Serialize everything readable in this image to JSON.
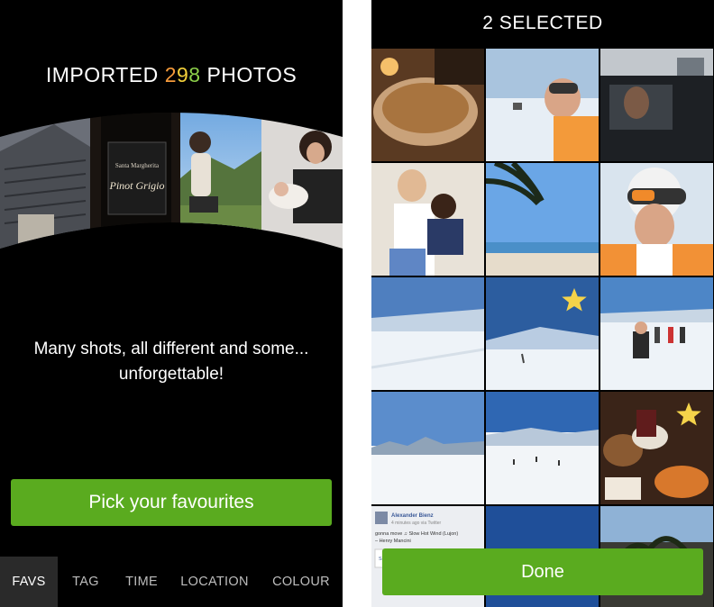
{
  "left": {
    "headline_prefix": "IMPORTED",
    "headline_count_digits": [
      "2",
      "9",
      "8"
    ],
    "headline_suffix": "PHOTOS",
    "carousel_photos": [
      "rooftops-photo",
      "wine-bottle-photo",
      "woman-landscape-photo",
      "mother-baby-photo"
    ],
    "wine_label": "Pinot Grigio",
    "message": "Many shots, all different and some... unforgettable!",
    "button_label": "Pick your favourites",
    "tabs": [
      {
        "label": "FAVS",
        "active": true
      },
      {
        "label": "TAG",
        "active": false
      },
      {
        "label": "TIME",
        "active": false
      },
      {
        "label": "LOCATION",
        "active": false
      },
      {
        "label": "COLOUR",
        "active": false
      }
    ],
    "colors": {
      "accent_green": "#5aab1f",
      "count_orange": "#f59a3b",
      "count_yellow": "#f2cf3a",
      "count_green": "#8cd04a"
    }
  },
  "right": {
    "title": "2 SELECTED",
    "done_label": "Done",
    "star_icon": "star-icon",
    "star_color": "#f5d34a",
    "grid": [
      {
        "name": "pastry-photo",
        "starred": false
      },
      {
        "name": "ski-selfie-photo",
        "starred": false
      },
      {
        "name": "car-interior-photo",
        "starred": false
      },
      {
        "name": "woman-child-photo",
        "starred": false
      },
      {
        "name": "palm-beach-photo",
        "starred": false
      },
      {
        "name": "skier-goggles-photo",
        "starred": false
      },
      {
        "name": "snow-slope-photo",
        "starred": false
      },
      {
        "name": "snow-sky-photo",
        "starred": true
      },
      {
        "name": "skiers-group-photo",
        "starred": false
      },
      {
        "name": "snow-mountains-photo",
        "starred": false
      },
      {
        "name": "snow-plain-photo",
        "starred": false
      },
      {
        "name": "food-table-photo",
        "starred": true
      },
      {
        "name": "facebook-post-photo",
        "starred": false
      },
      {
        "name": "blue-sky-photo",
        "starred": false
      },
      {
        "name": "beach-palms-photo",
        "starred": false
      }
    ],
    "facebook_post": {
      "author": "Alexander Bienz",
      "text": "gonna move ♫ Slow Hot Wind (Lujon) – Henry Mancini",
      "link": "Slow Hot Wind (Lujon)"
    }
  }
}
